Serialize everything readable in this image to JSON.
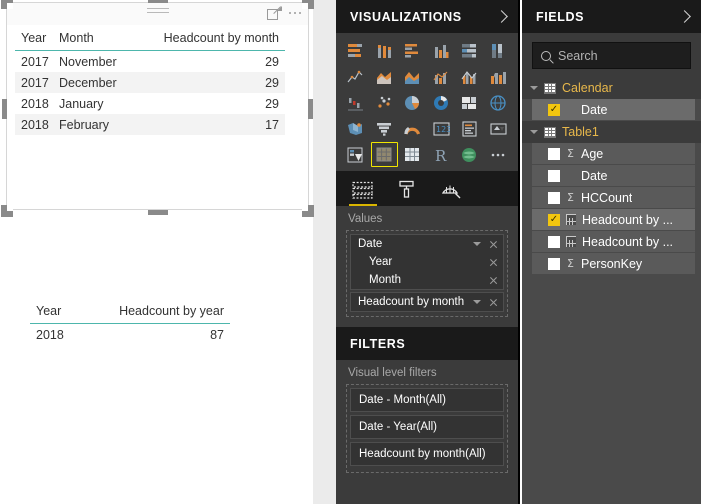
{
  "report": {
    "visual1": {
      "header_icons": [
        "drag-handle",
        "focus-mode-icon",
        "more-options-icon"
      ],
      "columns": [
        "Year",
        "Month",
        "Headcount by month"
      ],
      "rows": [
        [
          "2017",
          "November",
          "29"
        ],
        [
          "2017",
          "December",
          "29"
        ],
        [
          "2018",
          "January",
          "29"
        ],
        [
          "2018",
          "February",
          "17"
        ]
      ]
    },
    "visual2": {
      "columns": [
        "Year",
        "Headcount by year"
      ],
      "rows": [
        [
          "2018",
          "87"
        ]
      ]
    },
    "accent_underline": "#4db6ac"
  },
  "visualizations": {
    "title": "VISUALIZATIONS",
    "collapse_icon": "chevron-right-icon",
    "icons": [
      "stacked-bar-chart",
      "stacked-column-chart",
      "clustered-bar-chart",
      "clustered-column-chart",
      "100-percent-stacked-bar-chart",
      "100-percent-stacked-column-chart",
      "line-chart",
      "area-chart",
      "stacked-area-chart",
      "line-and-stacked-column-chart",
      "line-and-clustered-column-chart",
      "ribbon-chart",
      "waterfall-chart",
      "scatter-chart",
      "pie-chart",
      "donut-chart",
      "treemap",
      "map",
      "filled-map",
      "funnel-chart",
      "gauge-chart",
      "card",
      "multi-row-card",
      "kpi",
      "slicer",
      "table",
      "matrix",
      "r-script-visual",
      "arcgis-map",
      "more-visuals"
    ],
    "selected_icon": "table",
    "tabs": [
      {
        "name": "fields-tab",
        "icon": "fields-icon",
        "active": true
      },
      {
        "name": "format-tab",
        "icon": "paint-roller-icon",
        "active": false
      },
      {
        "name": "analytics-tab",
        "icon": "analytics-magnifier-icon",
        "active": false
      }
    ],
    "wells": {
      "values_label": "Values",
      "groups": [
        {
          "label": "Date",
          "has_caret": true,
          "has_remove": true,
          "children": [
            {
              "label": "Year",
              "has_remove": true
            },
            {
              "label": "Month",
              "has_remove": true
            }
          ]
        }
      ],
      "fields": [
        {
          "label": "Headcount by month",
          "has_caret": true,
          "has_remove": true
        }
      ]
    }
  },
  "filters": {
    "title": "FILTERS",
    "section_label": "Visual level filters",
    "items": [
      "Date - Month(All)",
      "Date - Year(All)",
      "Headcount by month(All)"
    ]
  },
  "fields": {
    "title": "FIELDS",
    "collapse_icon": "chevron-right-icon",
    "search_placeholder": "Search",
    "tables": [
      {
        "name": "Calendar",
        "expanded": true,
        "fields": [
          {
            "label": "Date",
            "checked": true,
            "kind": "plain"
          }
        ]
      },
      {
        "name": "Table1",
        "expanded": true,
        "fields": [
          {
            "label": "Age",
            "checked": false,
            "kind": "sigma"
          },
          {
            "label": "Date",
            "checked": false,
            "kind": "plain"
          },
          {
            "label": "HCCount",
            "checked": false,
            "kind": "sigma"
          },
          {
            "label": "Headcount by ...",
            "checked": true,
            "kind": "measure"
          },
          {
            "label": "Headcount by ...",
            "checked": false,
            "kind": "measure"
          },
          {
            "label": "PersonKey",
            "checked": false,
            "kind": "sigma"
          }
        ]
      }
    ]
  },
  "colors": {
    "accent_teal": "#4db6ac",
    "selection_yellow": "#f2e600",
    "checkbox_yellow": "#f2c60f",
    "table_name": "#e8b84b",
    "pane_bg": "#3b3b3b",
    "fields_bg": "#4a4a4a",
    "title_bg": "#1a1a1a"
  }
}
